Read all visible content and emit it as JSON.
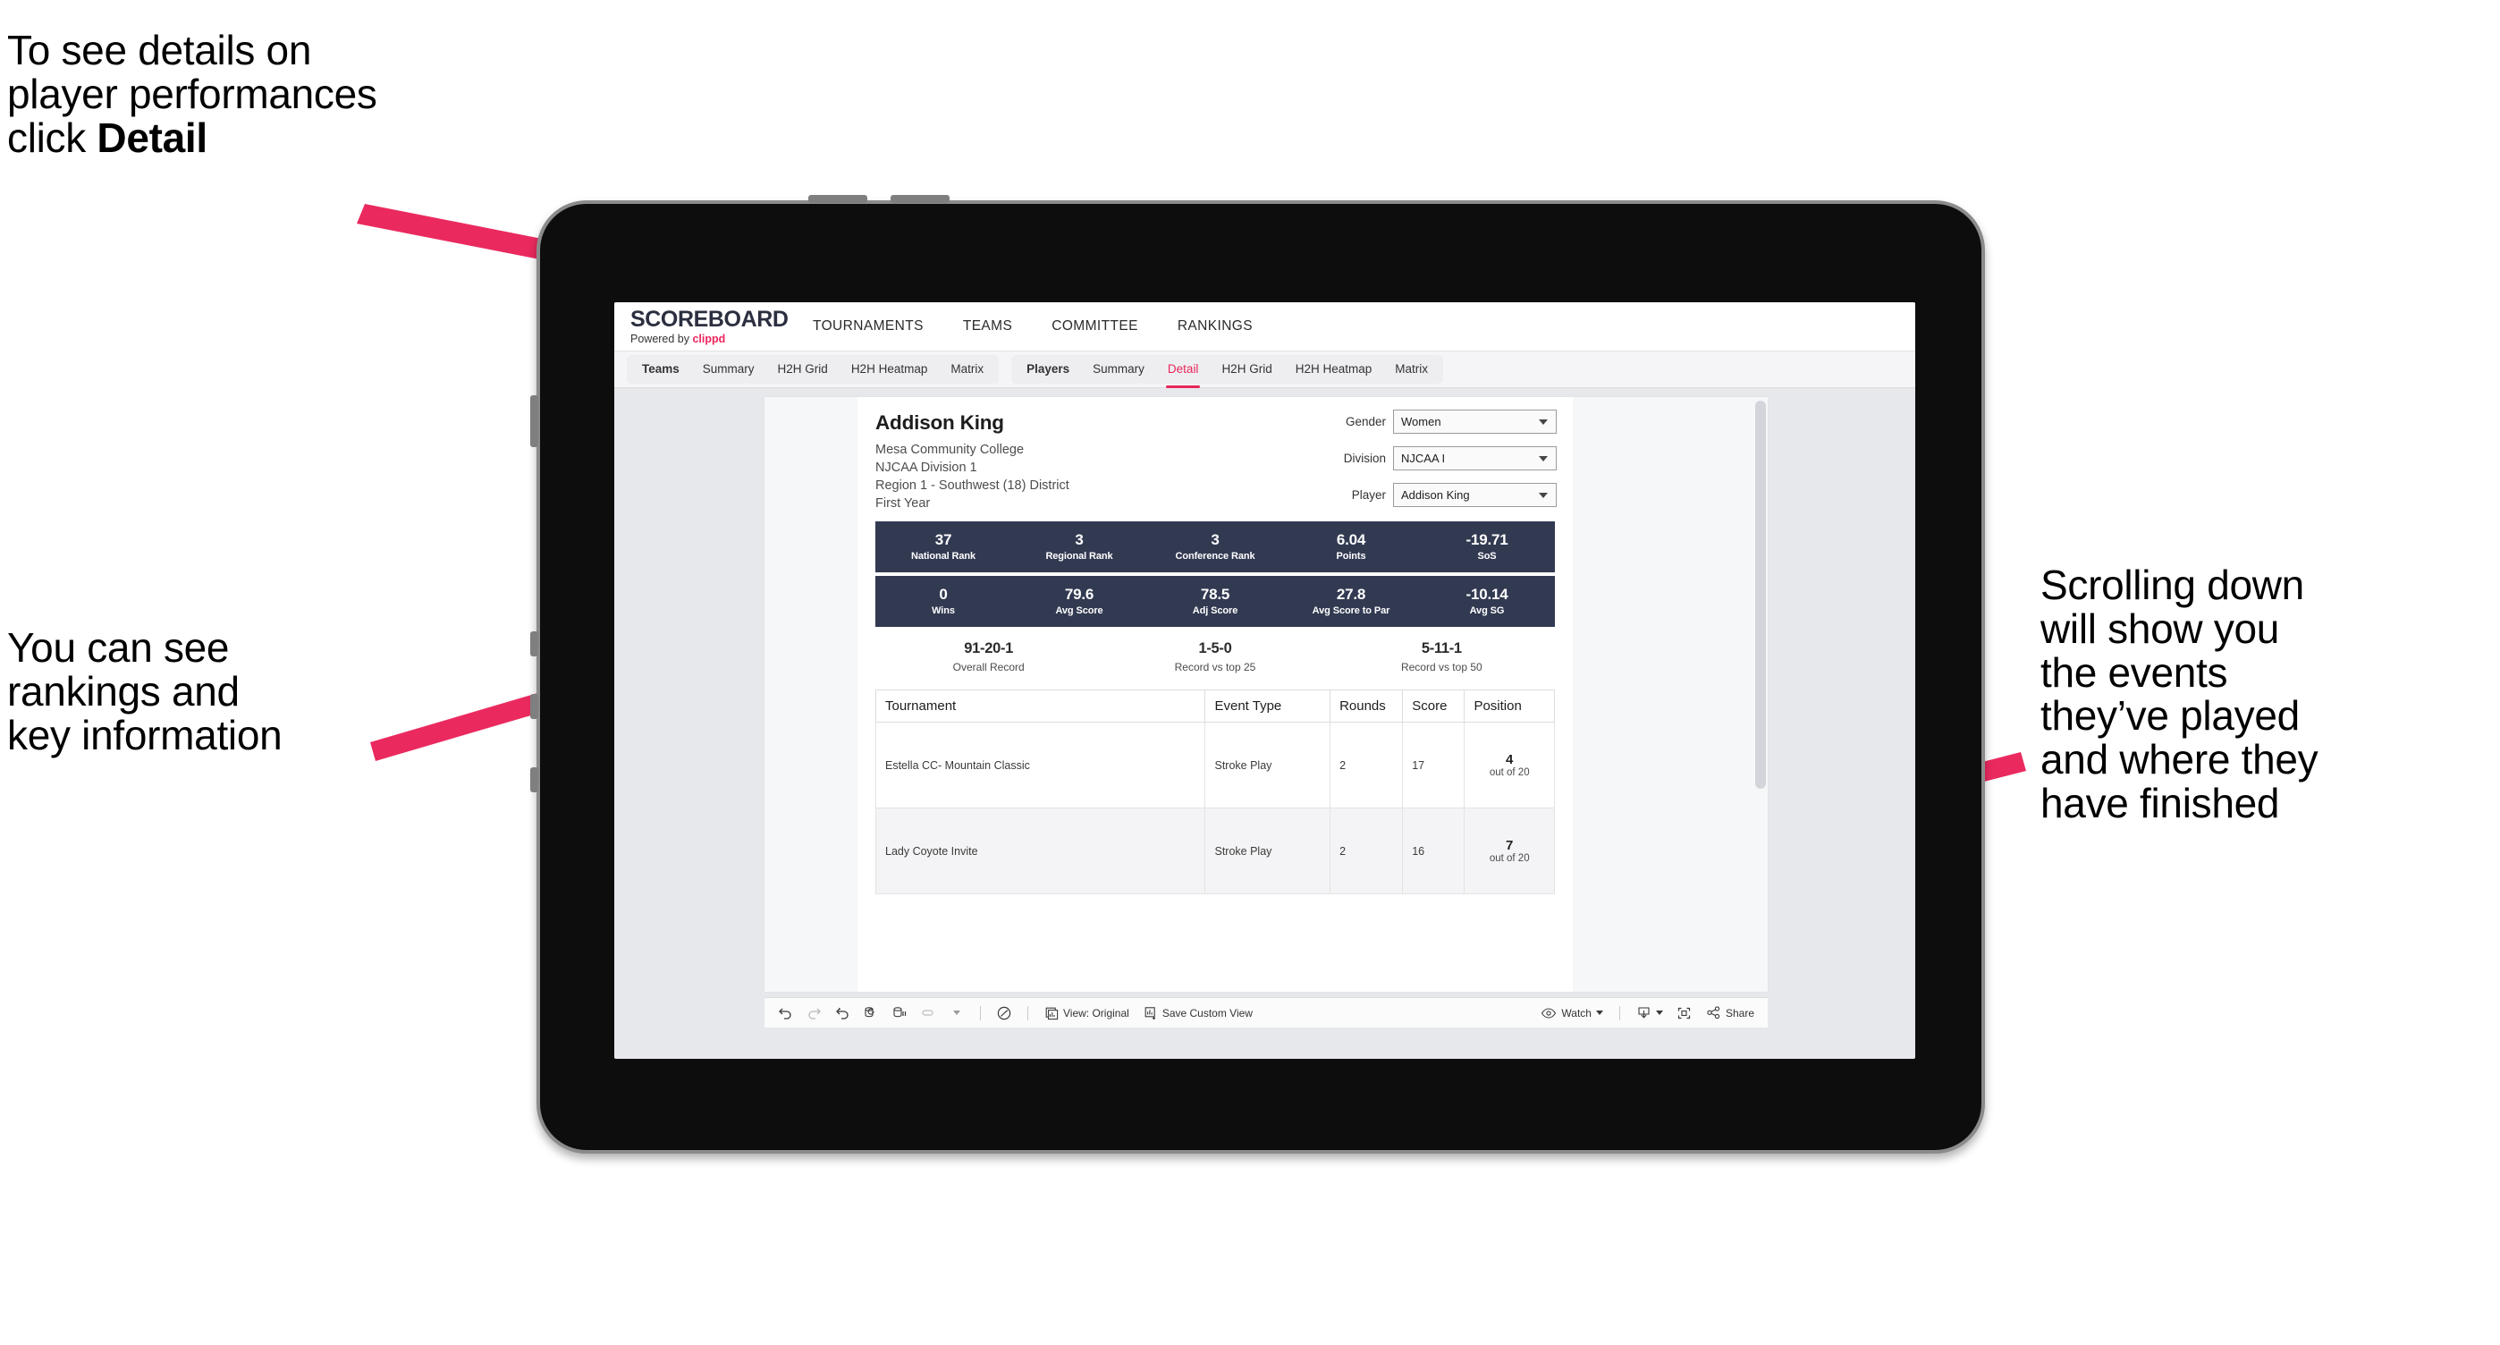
{
  "annotations": {
    "top_left": "To see details on\nplayer performances\nclick ",
    "top_left_bold": "Detail",
    "mid_left": "You can see\nrankings and\nkey information",
    "right": "Scrolling down\nwill show you\nthe events\nthey’ve played\nand where they\nhave finished",
    "arrow_color": "#ea2a5f"
  },
  "app": {
    "logo_word": "SCOREBOARD",
    "logo_sub_prefix": "Powered by ",
    "logo_brand": "clippd",
    "top_nav": [
      "TOURNAMENTS",
      "TEAMS",
      "COMMITTEE",
      "RANKINGS"
    ],
    "tabs_left": [
      "Teams",
      "Summary",
      "H2H Grid",
      "H2H Heatmap",
      "Matrix"
    ],
    "tabs_right": [
      "Players",
      "Summary",
      "Detail",
      "H2H Grid",
      "H2H Heatmap",
      "Matrix"
    ],
    "active_tab": "Detail",
    "accent_color": "#e8265a",
    "band_color": "#323a52"
  },
  "player": {
    "name": "Addison King",
    "school": "Mesa Community College",
    "division": "NJCAA Division 1",
    "region": "Region 1 - Southwest (18) District",
    "year": "First Year"
  },
  "filters": [
    {
      "label": "Gender",
      "value": "Women"
    },
    {
      "label": "Division",
      "value": "NJCAA I"
    },
    {
      "label": "Player",
      "value": "Addison King"
    }
  ],
  "stats_band_1": [
    {
      "value": "37",
      "label": "National Rank"
    },
    {
      "value": "3",
      "label": "Regional Rank"
    },
    {
      "value": "3",
      "label": "Conference Rank"
    },
    {
      "value": "6.04",
      "label": "Points"
    },
    {
      "value": "-19.71",
      "label": "SoS"
    }
  ],
  "stats_band_2": [
    {
      "value": "0",
      "label": "Wins"
    },
    {
      "value": "79.6",
      "label": "Avg Score"
    },
    {
      "value": "78.5",
      "label": "Adj Score"
    },
    {
      "value": "27.8",
      "label": "Avg Score to Par"
    },
    {
      "value": "-10.14",
      "label": "Avg SG"
    }
  ],
  "records": [
    {
      "value": "91-20-1",
      "label": "Overall Record"
    },
    {
      "value": "1-5-0",
      "label": "Record vs top 25"
    },
    {
      "value": "5-11-1",
      "label": "Record vs top 50"
    }
  ],
  "table": {
    "columns": [
      "Tournament",
      "Event Type",
      "Rounds",
      "Score",
      "Position"
    ],
    "rows": [
      {
        "tournament": "Estella CC- Mountain Classic",
        "event_type": "Stroke Play",
        "rounds": "2",
        "score": "17",
        "position": "4",
        "position_of": "out of 20"
      },
      {
        "tournament": "Lady Coyote Invite",
        "event_type": "Stroke Play",
        "rounds": "2",
        "score": "16",
        "position": "7",
        "position_of": "out of 20"
      }
    ]
  },
  "toolbar": {
    "view_label": "View: Original",
    "save_label": "Save Custom View",
    "watch_label": "Watch",
    "share_label": "Share"
  }
}
